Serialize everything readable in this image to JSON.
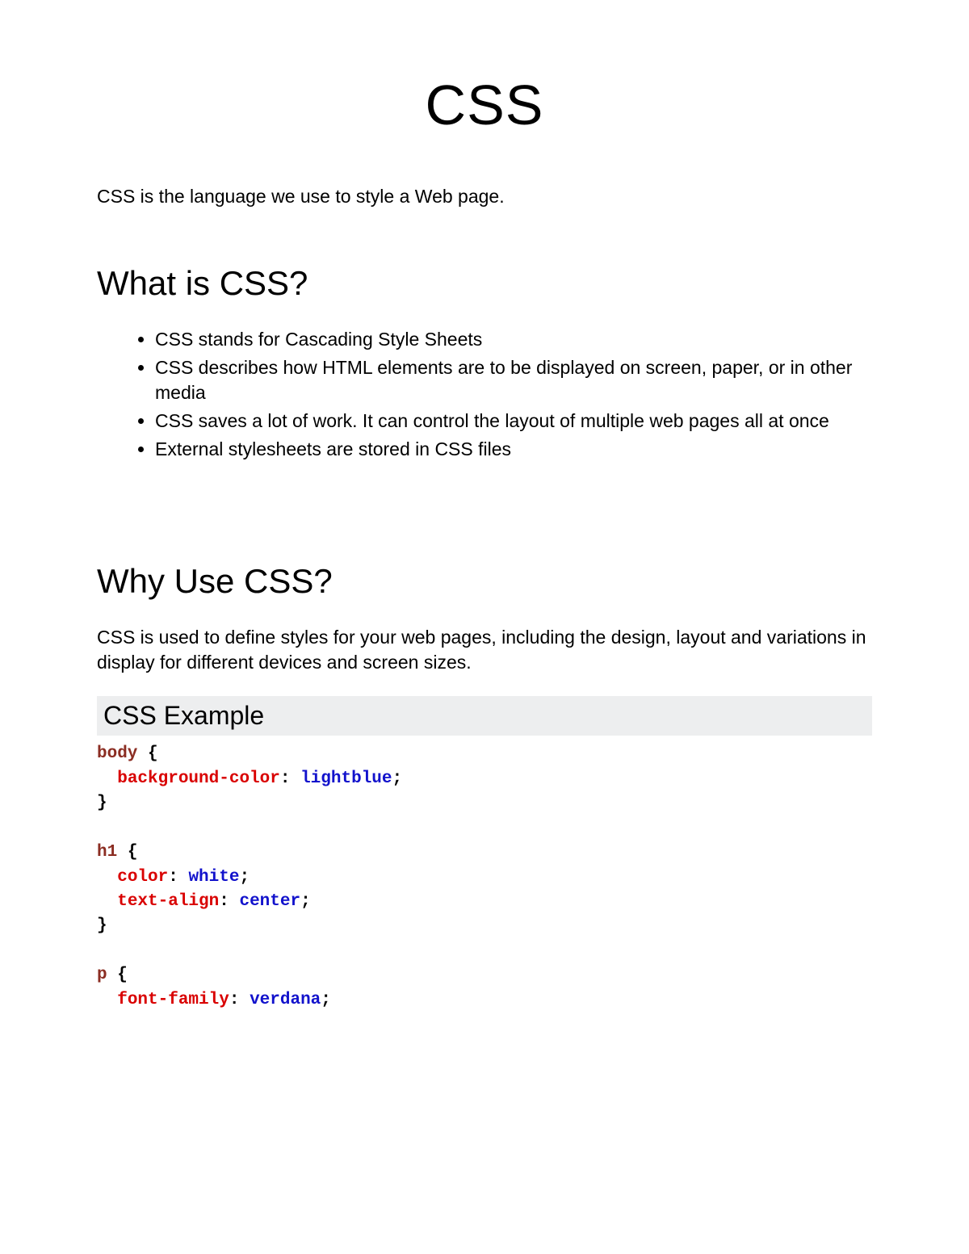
{
  "title": "CSS",
  "intro": "CSS is the language we use to style a Web page.",
  "what": {
    "heading": "What is CSS?",
    "bullets": [
      "CSS stands for Cascading Style Sheets",
      "CSS describes how HTML elements are to be displayed on screen, paper, or in other media",
      "CSS saves a lot of work. It can control the layout of multiple web pages all at once",
      "External stylesheets are stored in CSS files"
    ]
  },
  "why": {
    "heading": "Why Use CSS?",
    "paragraph": "CSS is used to define styles for your web pages, including the design, layout and variations in display for different devices and screen sizes."
  },
  "example": {
    "heading": "CSS Example",
    "rules": [
      {
        "selector": "body",
        "declarations": [
          {
            "property": "background-color",
            "value": "lightblue"
          }
        ]
      },
      {
        "selector": "h1",
        "declarations": [
          {
            "property": "color",
            "value": "white"
          },
          {
            "property": "text-align",
            "value": "center"
          }
        ]
      },
      {
        "selector": "p",
        "declarations": [
          {
            "property": "font-family",
            "value": "verdana"
          }
        ],
        "open": true
      }
    ]
  }
}
